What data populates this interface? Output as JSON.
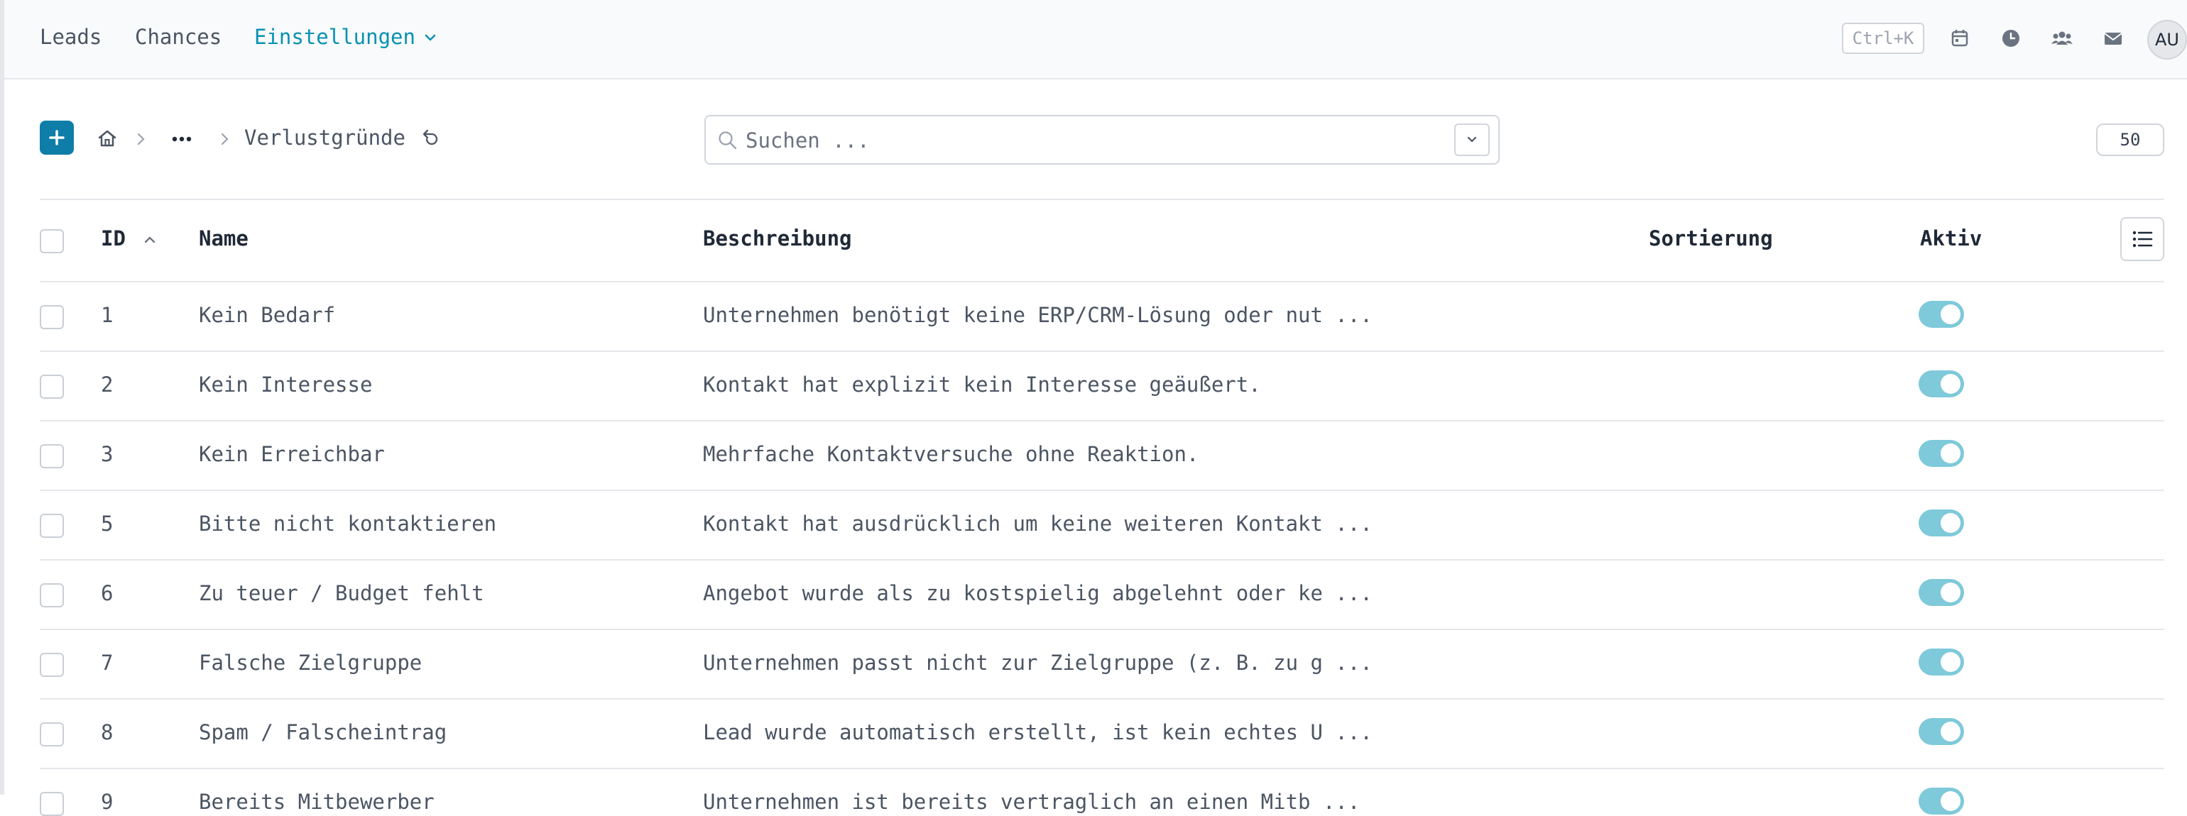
{
  "nav": {
    "items": [
      {
        "label": "Leads"
      },
      {
        "label": "Chances"
      },
      {
        "label": "Einstellungen"
      }
    ],
    "shortcut": "Ctrl+K",
    "icons": [
      "calendar-icon",
      "clock-icon",
      "users-icon",
      "mail-icon"
    ],
    "avatar_initials": "AU"
  },
  "toolbar": {
    "add_label": "+",
    "breadcrumb_current": "Verlustgründe",
    "search_placeholder": "Suchen ...",
    "page_size": "50"
  },
  "table": {
    "headers": {
      "id": "ID",
      "name": "Name",
      "description": "Beschreibung",
      "sort": "Sortierung",
      "active": "Aktiv"
    },
    "rows": [
      {
        "id": "1",
        "name": "Kein Bedarf",
        "description": "Unternehmen benötigt keine ERP/CRM-Lösung oder nut ...",
        "active": true
      },
      {
        "id": "2",
        "name": "Kein Interesse",
        "description": "Kontakt hat explizit kein Interesse geäußert.",
        "active": true
      },
      {
        "id": "3",
        "name": "Kein Erreichbar",
        "description": "Mehrfache Kontaktversuche ohne Reaktion.",
        "active": true
      },
      {
        "id": "5",
        "name": "Bitte nicht kontaktieren",
        "description": "Kontakt hat ausdrücklich um keine weiteren Kontakt ...",
        "active": true
      },
      {
        "id": "6",
        "name": "Zu teuer / Budget fehlt",
        "description": "Angebot wurde als zu kostspielig abgelehnt oder ke ...",
        "active": true
      },
      {
        "id": "7",
        "name": "Falsche Zielgruppe",
        "description": "Unternehmen passt nicht zur Zielgruppe (z. B. zu g ...",
        "active": true
      },
      {
        "id": "8",
        "name": "Spam / Falscheintrag",
        "description": "Lead wurde automatisch erstellt, ist kein echtes U ...",
        "active": true
      },
      {
        "id": "9",
        "name": "Bereits Mitbewerber",
        "description": "Unternehmen ist bereits vertraglich an einen Mitb ...",
        "active": true
      }
    ]
  },
  "colors": {
    "accent": "#0891b2",
    "button": "#0e7ea8",
    "toggle_on": "#7ec9da"
  }
}
